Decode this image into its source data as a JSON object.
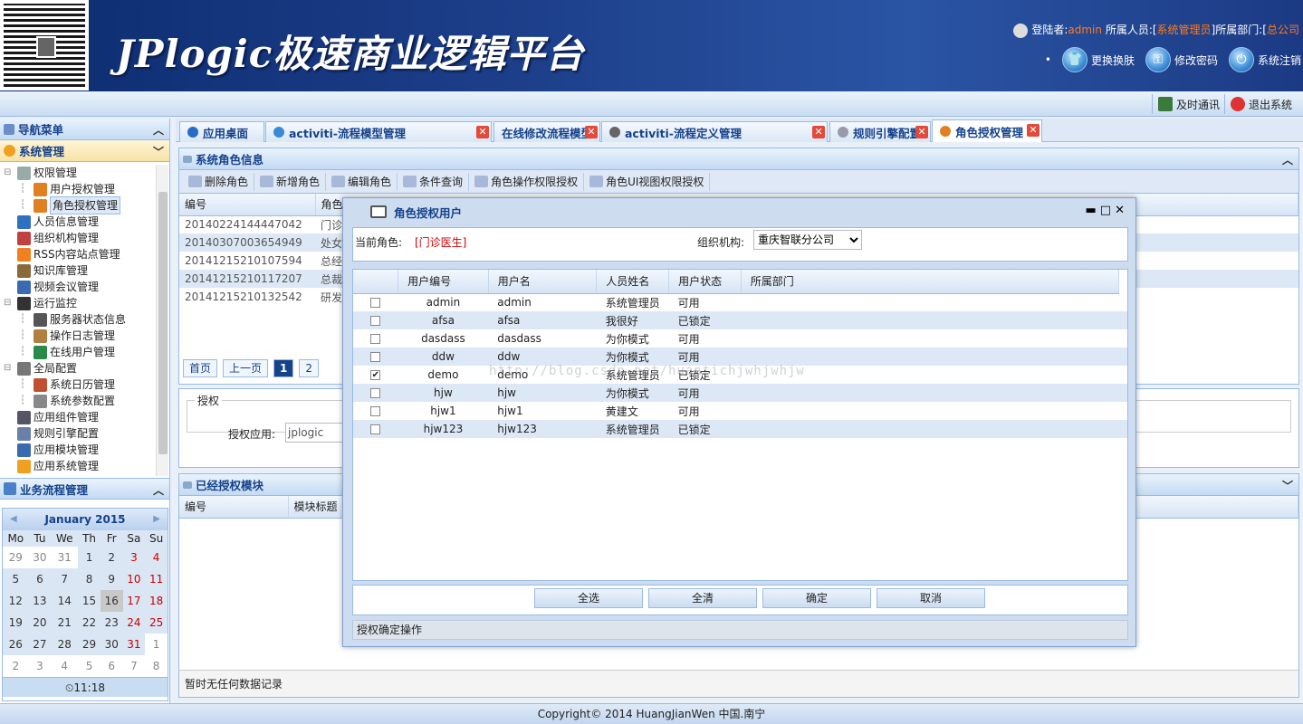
{
  "header": {
    "logo_text": "JPlogic极速商业逻辑平台",
    "login_prefix": "登陆者:",
    "login_user": "admin",
    "role_prefix": "所属人员:[",
    "role_value": "系统管理员",
    "dept_prefix": "]所属部门:[",
    "dept_value": "总公司",
    "skin_label": "更换换肤",
    "password_label": "修改密码",
    "logout_label": "系统注销"
  },
  "topbar": {
    "instant_msg": "及时通讯",
    "exit": "退出系统"
  },
  "left": {
    "nav_title": "导航菜单",
    "system_title": "系统管理",
    "workflow_title": "业务流程管理",
    "tree": [
      {
        "label": "权限管理",
        "icon": "folder-gear-icon",
        "level": 0
      },
      {
        "label": "用户授权管理",
        "icon": "user-icon",
        "level": 1
      },
      {
        "label": "角色授权管理",
        "icon": "users-icon",
        "level": 1,
        "selected": true
      },
      {
        "label": "人员信息管理",
        "icon": "people-icon",
        "level": 0
      },
      {
        "label": "组织机构管理",
        "icon": "org-icon",
        "level": 0
      },
      {
        "label": "RSS内容站点管理",
        "icon": "rss-icon",
        "level": 0
      },
      {
        "label": "知识库管理",
        "icon": "book-icon",
        "level": 0
      },
      {
        "label": "视频会议管理",
        "icon": "video-icon",
        "level": 0
      },
      {
        "label": "运行监控",
        "icon": "monitor-icon",
        "level": 0
      },
      {
        "label": "服务器状态信息",
        "icon": "server-icon",
        "level": 1
      },
      {
        "label": "操作日志管理",
        "icon": "log-icon",
        "level": 1
      },
      {
        "label": "在线用户管理",
        "icon": "online-user-icon",
        "level": 1
      },
      {
        "label": "全局配置",
        "icon": "wrench-icon",
        "level": 0
      },
      {
        "label": "系统日历管理",
        "icon": "calendar-icon",
        "level": 1
      },
      {
        "label": "系统参数配置",
        "icon": "gear-icon",
        "level": 1
      },
      {
        "label": "应用组件管理",
        "icon": "component-icon",
        "level": 0
      },
      {
        "label": "规则引擎配置",
        "icon": "rule-icon",
        "level": 0
      },
      {
        "label": "应用模块管理",
        "icon": "module-icon",
        "level": 0
      },
      {
        "label": "应用系统管理",
        "icon": "app-gear-icon",
        "level": 0
      }
    ]
  },
  "calendar": {
    "month": "January 2015",
    "weekdays": [
      "Mo",
      "Tu",
      "We",
      "Th",
      "Fr",
      "Sa",
      "Su"
    ],
    "weeks": [
      [
        "29",
        "30",
        "31",
        "1",
        "2",
        "3",
        "4"
      ],
      [
        "5",
        "6",
        "7",
        "8",
        "9",
        "10",
        "11"
      ],
      [
        "12",
        "13",
        "14",
        "15",
        "16",
        "17",
        "18"
      ],
      [
        "19",
        "20",
        "21",
        "22",
        "23",
        "24",
        "25"
      ],
      [
        "26",
        "27",
        "28",
        "29",
        "30",
        "31",
        "1"
      ],
      [
        "2",
        "3",
        "4",
        "5",
        "6",
        "7",
        "8"
      ]
    ],
    "time": "11:18"
  },
  "tabs": [
    {
      "label": "应用桌面",
      "icon": "desktop-icon",
      "closable": false
    },
    {
      "label": "activiti-流程模型管理",
      "icon": "gear-icon",
      "closable": true
    },
    {
      "label": "在线修改流程模型",
      "icon": "",
      "closable": true
    },
    {
      "label": "activiti-流程定义管理",
      "icon": "grid-icon",
      "closable": true
    },
    {
      "label": "规则引擎配置",
      "icon": "rule-icon",
      "closable": true
    },
    {
      "label": "角色授权管理",
      "icon": "users-icon",
      "closable": true,
      "active": true
    }
  ],
  "role_panel": {
    "title": "系统角色信息",
    "toolbar": [
      "删除角色",
      "新增角色",
      "编辑角色",
      "条件查询",
      "角色操作权限授权",
      "角色UI视图权限授权"
    ],
    "columns": [
      "编号",
      "角色"
    ],
    "rows": [
      [
        "20140224144447042",
        "门诊"
      ],
      [
        "20140307003654949",
        "处女"
      ],
      [
        "20141215210107594",
        "总经"
      ],
      [
        "20141215210117207",
        "总裁"
      ],
      [
        "20141215210132542",
        "研发"
      ]
    ],
    "pager": {
      "first": "首页",
      "prev": "上一页",
      "pages": [
        "1",
        "2"
      ]
    }
  },
  "auth_panel": {
    "legend": "授权",
    "label": "授权应用:",
    "value": "jplogic"
  },
  "module_panel": {
    "title": "已经授权模块",
    "columns": [
      "编号",
      "模块标题"
    ],
    "empty": "暂时无任何数据记录"
  },
  "modal": {
    "title": "角色授权用户",
    "current_role_label": "当前角色:",
    "current_role_value": "[门诊医生]",
    "org_label": "组织机构:",
    "org_value": "重庆智联分公司",
    "columns": [
      "用户编号",
      "用户名",
      "人员姓名",
      "用户状态",
      "所属部门"
    ],
    "rows": [
      {
        "id": "admin",
        "name": "admin",
        "person": "系统管理员",
        "status": "可用",
        "dept": "",
        "checked": false
      },
      {
        "id": "afsa",
        "name": "afsa",
        "person": "我很好",
        "status": "已锁定",
        "dept": "",
        "checked": false
      },
      {
        "id": "dasdass",
        "name": "dasdass",
        "person": "为你模式",
        "status": "可用",
        "dept": "",
        "checked": false
      },
      {
        "id": "ddw",
        "name": "ddw",
        "person": "为你模式",
        "status": "可用",
        "dept": "",
        "checked": false
      },
      {
        "id": "demo",
        "name": "demo",
        "person": "系统管理员",
        "status": "已锁定",
        "dept": "",
        "checked": true
      },
      {
        "id": "hjw",
        "name": "hjw",
        "person": "为你模式",
        "status": "可用",
        "dept": "",
        "checked": false
      },
      {
        "id": "hjw1",
        "name": "hjw1",
        "person": "黄建文",
        "status": "可用",
        "dept": "",
        "checked": false
      },
      {
        "id": "hjw123",
        "name": "hjw123",
        "person": "系统管理员",
        "status": "已锁定",
        "dept": "",
        "checked": false
      }
    ],
    "buttons": {
      "select_all": "全选",
      "clear_all": "全清",
      "ok": "确定",
      "cancel": "取消"
    },
    "status": "授权确定操作"
  },
  "watermark": "http://blog.csdn.net/huantichjwhjwhjw",
  "footer": "Copyright© 2014 HuangJianWen 中国.南宁"
}
